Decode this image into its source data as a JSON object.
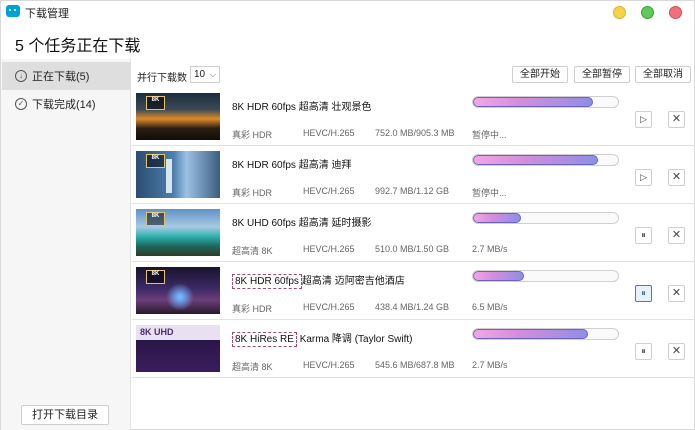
{
  "window": {
    "title": "下载管理"
  },
  "heading": "5 个任务正在下载",
  "sidebar": {
    "items": [
      {
        "label": "正在下载(5)",
        "active": true,
        "icon": "download-circle-icon"
      },
      {
        "label": "下载完成(14)",
        "active": false,
        "icon": "check-circle-icon"
      }
    ],
    "open_dir_label": "打开下载目录"
  },
  "toolbar": {
    "concurrency_label": "并行下载数",
    "concurrency_value": "10",
    "start_all_label": "全部开始",
    "pause_all_label": "全部暂停",
    "cancel_all_label": "全部取消"
  },
  "downloads": [
    {
      "badge": "8K",
      "title_prefix": "",
      "title": "8K HDR 60fps 超高清 壮观景色",
      "quality": "真彩 HDR",
      "codec": "HEVC/H.265",
      "size": "752.0 MB/905.3 MB",
      "status": "暂停中...",
      "progress": 0.83,
      "action_icon": "play-icon",
      "action_symbol": "▷"
    },
    {
      "badge": "8K",
      "title_prefix": "",
      "title": "8K HDR 60fps 超高清 迪拜",
      "quality": "真彩 HDR",
      "codec": "HEVC/H.265",
      "size": "992.7 MB/1.12 GB",
      "status": "暂停中...",
      "progress": 0.86,
      "action_icon": "play-icon",
      "action_symbol": "▷"
    },
    {
      "badge": "8K",
      "title_prefix": "",
      "title": "8K UHD 60fps 超高清 延时摄影",
      "quality": "超高清 8K",
      "codec": "HEVC/H.265",
      "size": "510.0 MB/1.50 GB",
      "status": "2.7 MB/s",
      "progress": 0.33,
      "action_icon": "pause-icon",
      "action_symbol": "⏸"
    },
    {
      "badge": "8K",
      "title_prefix": "8K HDR 60fps",
      "title": "超高清 迈阿密吉他酒店",
      "quality": "真彩 HDR",
      "codec": "HEVC/H.265",
      "size": "438.4 MB/1.24 GB",
      "status": "6.5 MB/s",
      "progress": 0.35,
      "action_icon": "pause-icon",
      "action_symbol": "⏸",
      "highlight": true
    },
    {
      "badge": "8K UHD",
      "title_prefix": "8K HiRes RE",
      "title": "Karma 降调 (Taylor Swift)",
      "quality": "超高清 8K",
      "codec": "HEVC/H.265",
      "size": "545.6 MB/687.8 MB",
      "status": "2.7 MB/s",
      "progress": 0.79,
      "action_icon": "pause-icon",
      "action_symbol": "⏸"
    }
  ]
}
